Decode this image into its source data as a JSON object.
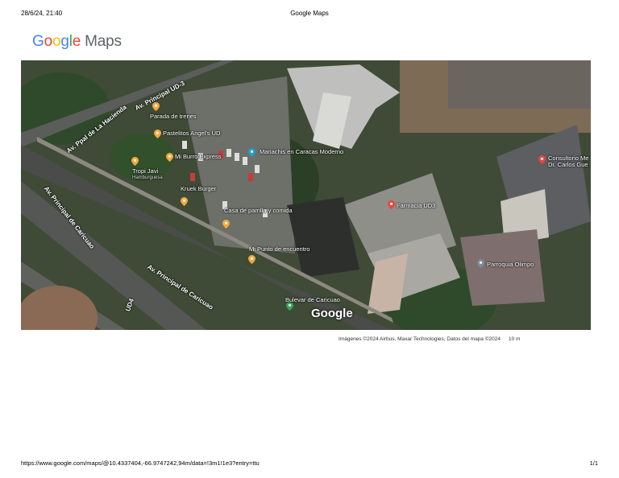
{
  "header": {
    "datetime": "28/6/24, 21:40",
    "page_title": "Google Maps"
  },
  "logo": {
    "word": "Google",
    "product": "Maps"
  },
  "map": {
    "watermark": "Google",
    "places": [
      {
        "name": "Mariachis en Caracas Moderno",
        "sub": "",
        "color": "#1ea1c4"
      },
      {
        "name": "Farmacia UD3",
        "sub": "",
        "color": "#e8453c"
      },
      {
        "name": "Consultorio Me Dr. Carlos Gue",
        "sub": "",
        "color": "#e8453c"
      },
      {
        "name": "Parroquia Olimpo",
        "sub": "",
        "color": "#7a8a99"
      },
      {
        "name": "Parada de trenes",
        "sub": "",
        "color": "#f2a93b"
      },
      {
        "name": "Pastelitos Angel's UD",
        "sub": "",
        "color": "#f2a93b"
      },
      {
        "name": "Mi Burro Express",
        "sub": "",
        "color": "#f2a93b"
      },
      {
        "name": "Tropi Javi",
        "sub": "Hamburguesa",
        "color": "#f2a93b"
      },
      {
        "name": "Kruek Burger",
        "sub": "",
        "color": "#f2a93b"
      },
      {
        "name": "Casa de parrilla y comida",
        "sub": "",
        "color": "#f2a93b"
      },
      {
        "name": "Mi Punto de encuentro",
        "sub": "",
        "color": "#f2a93b"
      },
      {
        "name": "Bulevar de Caricuao",
        "sub": "",
        "color": "#34a853"
      }
    ],
    "roads": [
      "Av. Principal UD-3",
      "Av. Ppal de La Hacienda",
      "Av. Principal de Caricuao",
      "Av. Principal de Caricuao",
      "UD4"
    ]
  },
  "attribution": {
    "text": "Imágenes ©2024 Airbus, Maxar Technologies, Datos del mapa ©2024",
    "scale": "10 m"
  },
  "footer": {
    "url": "https://www.google.com/maps/@10.4337404,-66.9747242,94m/data=!3m1!1e3?entry=ttu",
    "page": "1/1"
  }
}
